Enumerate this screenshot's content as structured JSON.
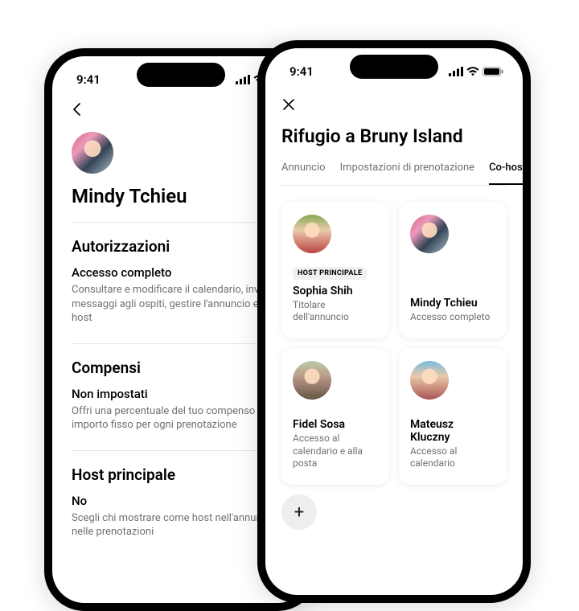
{
  "status": {
    "time": "9:41"
  },
  "back": {
    "profile_name": "Mindy Tchieu",
    "sections": [
      {
        "title": "Autorizzazioni",
        "sub": "Accesso completo",
        "desc": "Consultare e modificare il calendario, inviare messaggi agli ospiti, gestire l'annuncio e i co-host"
      },
      {
        "title": "Compensi",
        "sub": "Non impostati",
        "desc": "Offri una percentuale del tuo compenso o un importo fisso per ogni prenotazione"
      },
      {
        "title": "Host principale",
        "sub": "No",
        "desc": "Scegli chi mostrare come host nell'annuncio e nelle prenotazioni"
      }
    ]
  },
  "front": {
    "title": "Rifugio a Bruny Island",
    "tabs": [
      {
        "label": "Annuncio",
        "active": false
      },
      {
        "label": "Impostazioni di prenotazione",
        "active": false
      },
      {
        "label": "Co-host",
        "active": true
      }
    ],
    "hosts": [
      {
        "badge": "HOST PRINCIPALE",
        "name": "Sophia Shih",
        "sub": "Titolare dell'annuncio"
      },
      {
        "badge": "",
        "name": "Mindy Tchieu",
        "sub": "Accesso completo"
      },
      {
        "badge": "",
        "name": "Fidel Sosa",
        "sub": "Accesso al calendario e alla posta"
      },
      {
        "badge": "",
        "name": "Mateusz Kluczny",
        "sub": "Accesso al calendario"
      }
    ]
  }
}
